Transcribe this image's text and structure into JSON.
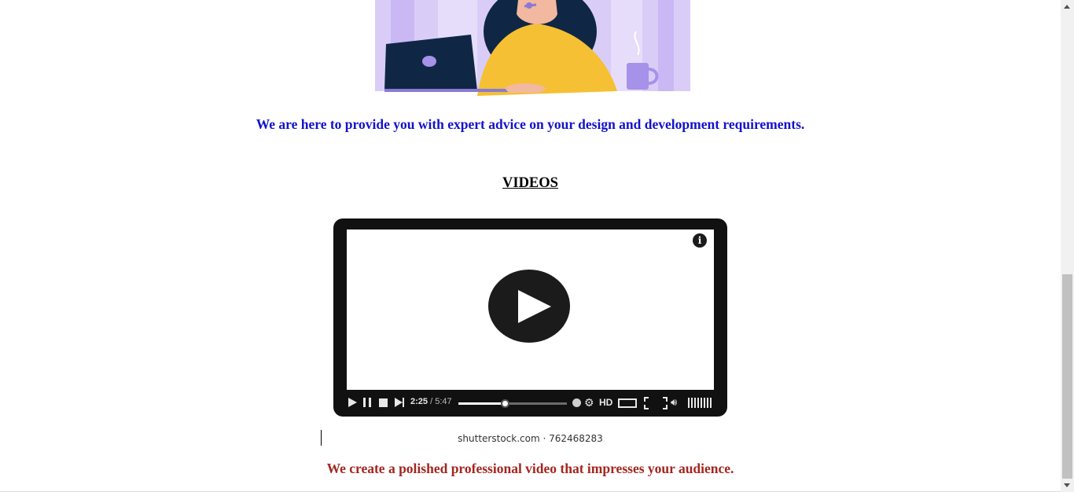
{
  "hero": {
    "image_icon": "customer-support-illustration",
    "colors": {
      "background": "#d6c8f7",
      "sweater": "#f5c033",
      "laptop": "#0f2744",
      "hair": "#0f2744",
      "mug": "#a692e8"
    }
  },
  "tagline": {
    "text": "We are here to provide you with expert advice on your design and development requirements.",
    "color": "#1212cc"
  },
  "section": {
    "title": "VIDEOS"
  },
  "video": {
    "current_time": "2:25",
    "separator": " / ",
    "duration": "5:47",
    "progress": 0.43,
    "quality_label": "HD",
    "info_label": "i",
    "icons": [
      "play-icon",
      "pause-icon",
      "stop-icon",
      "next-icon",
      "clock-icon",
      "gear-icon",
      "wide-icon",
      "fullscreen-icon",
      "volume-icon"
    ]
  },
  "watermark": {
    "text": "shutterstock.com · 762468283"
  },
  "closing": {
    "text": "We create a polished professional video that impresses your audience.",
    "color": "#a3261f"
  },
  "scrollbar": {
    "position": 0.56
  }
}
